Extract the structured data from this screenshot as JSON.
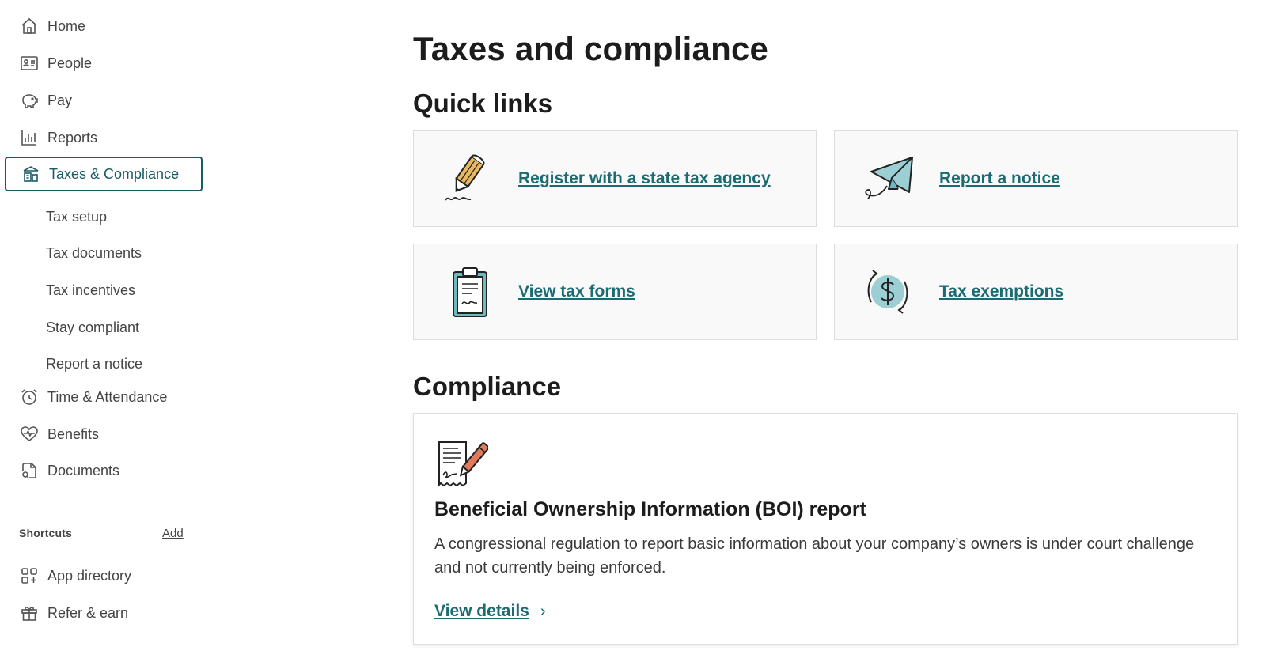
{
  "sidebar": {
    "items": [
      {
        "label": "Home",
        "icon": "home-icon"
      },
      {
        "label": "People",
        "icon": "people-card-icon"
      },
      {
        "label": "Pay",
        "icon": "piggy-bank-icon"
      },
      {
        "label": "Reports",
        "icon": "bar-chart-icon"
      },
      {
        "label": "Taxes & Compliance",
        "icon": "building-icon",
        "active": true
      },
      {
        "label": "Time & Attendance",
        "icon": "clock-icon"
      },
      {
        "label": "Benefits",
        "icon": "heart-pulse-icon"
      },
      {
        "label": "Documents",
        "icon": "document-search-icon"
      }
    ],
    "sub_items": [
      "Tax setup",
      "Tax documents",
      "Tax incentives",
      "Stay compliant",
      "Report a notice"
    ],
    "shortcuts_label": "Shortcuts",
    "shortcuts_add": "Add",
    "bottom_items": [
      {
        "label": "App directory",
        "icon": "app-grid-icon"
      },
      {
        "label": "Refer & earn",
        "icon": "gift-icon"
      }
    ]
  },
  "main": {
    "title": "Taxes and compliance",
    "quick_links_title": "Quick links",
    "quick_links": [
      {
        "label": "Register with a state tax agency",
        "icon": "pencil-illustration"
      },
      {
        "label": "Report a notice",
        "icon": "paper-plane-illustration"
      },
      {
        "label": "View tax forms",
        "icon": "clipboard-illustration"
      },
      {
        "label": "Tax exemptions",
        "icon": "dollar-cycle-illustration"
      }
    ],
    "compliance_title": "Compliance",
    "compliance_card": {
      "title": "Beneficial Ownership Information (BOI) report",
      "description": "A congressional regulation to report basic information about your company’s owners is under court challenge and not currently being enforced.",
      "link": "View details",
      "link_chevron": "›"
    }
  },
  "colors": {
    "accent": "#1a6b72",
    "active_border": "#1a5c63",
    "card_bg": "#f9f9f9",
    "illustration_teal": "#7cc3c9",
    "illustration_orange": "#e07a5a",
    "illustration_yellow": "#e8b860"
  }
}
